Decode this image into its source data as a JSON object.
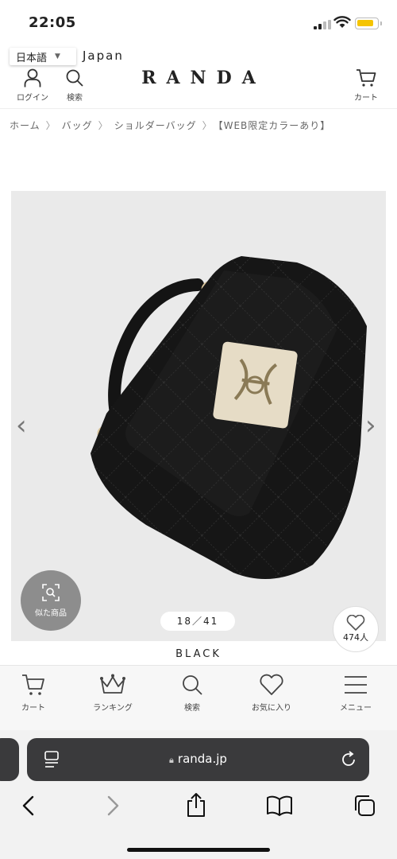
{
  "status": {
    "time": "22:05"
  },
  "language": {
    "selected": "日本語",
    "region": "Japan"
  },
  "header": {
    "login_label": "ログイン",
    "search_label": "検索",
    "logo": "RANDA",
    "cart_label": "カート"
  },
  "breadcrumb": [
    "ホーム",
    "バッグ",
    "ショルダーバッグ",
    "【WEB限定カラーあり】"
  ],
  "product": {
    "similar_label": "似た商品",
    "counter": "18／41",
    "favorite_count": "474人",
    "color_name": "BLACK"
  },
  "bottom_nav": {
    "cart": "カート",
    "ranking": "ランキング",
    "search": "検索",
    "favorites": "お気に入り",
    "menu": "メニュー"
  },
  "browser": {
    "url": "randa.jp"
  },
  "colors": {
    "battery": "#f5c400",
    "address_bar": "#3a3a3c",
    "image_bg": "#eaeaea",
    "bag": "#161616",
    "clasp": "#d8c39a"
  }
}
